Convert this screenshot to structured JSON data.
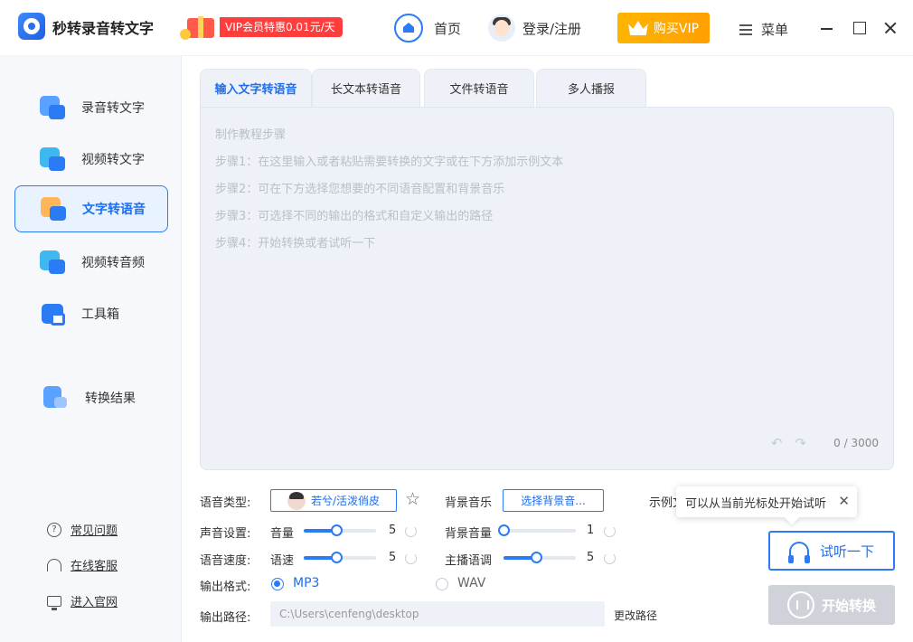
{
  "app": {
    "title": "秒转录音转文字",
    "vip_promo": "VIP会员特惠0.01元/天",
    "nav_home": "首页",
    "nav_login": "登录/注册",
    "buy_vip": "购买VIP",
    "menu": "菜单"
  },
  "sidebar": {
    "items": [
      {
        "label": "录音转文字",
        "icon": "mic-text-icon"
      },
      {
        "label": "视频转文字",
        "icon": "video-text-icon"
      },
      {
        "label": "文字转语音",
        "icon": "text-speech-icon"
      },
      {
        "label": "视频转音频",
        "icon": "video-audio-icon"
      },
      {
        "label": "工具箱",
        "icon": "toolbox-icon"
      },
      {
        "label": "转换结果",
        "icon": "result-icon"
      }
    ],
    "active_index": 2,
    "bottom": [
      {
        "label": "常见问题",
        "icon": "question-icon"
      },
      {
        "label": "在线客服",
        "icon": "headset-icon"
      },
      {
        "label": "进入官网",
        "icon": "monitor-icon"
      }
    ]
  },
  "tabs": [
    {
      "label": "输入文字转语音",
      "active": true
    },
    {
      "label": "长文本转语音",
      "active": false
    },
    {
      "label": "文件转语音",
      "active": false
    },
    {
      "label": "多人播报",
      "active": false
    }
  ],
  "editor": {
    "hint_title": "制作教程步骤",
    "steps": [
      "步骤1：在这里输入或者粘贴需要转换的文字或在下方添加示例文本",
      "步骤2：可在下方选择您想要的不同语音配置和背景音乐",
      "步骤3：可选择不同的输出的格式和自定义输出的路径",
      "步骤4：开始转换或者试听一下"
    ],
    "char_count": "0 / 3000"
  },
  "settings": {
    "voice_type_label": "语音类型:",
    "voice_name": "若兮/活泼俏皮",
    "bgm_label": "背景音乐",
    "bgm_button": "选择背景音...",
    "sound_label": "声音设置:",
    "volume_label": "音量",
    "volume_value": "5",
    "volume_level": 0.45,
    "bgm_volume_label": "背景音量",
    "bgm_volume_value": "1",
    "bgm_volume_level": 0.0,
    "speed_row_label": "语音速度:",
    "speed_label": "语速",
    "speed_value": "5",
    "speed_level": 0.45,
    "tone_label": "主播语调",
    "tone_value": "5",
    "tone_level": 0.45,
    "format_label": "输出格式:",
    "format_options": [
      "MP3",
      "WAV"
    ],
    "format_selected": "MP3",
    "path_label": "输出路径:",
    "path_value": "C:\\Users\\cenfeng\\desktop",
    "change_path": "更改路径"
  },
  "actions": {
    "example_label": "示例文",
    "tooltip": "可以从当前光标处开始试听",
    "listen_button": "试听一下",
    "start_button": "开始转换"
  },
  "colors": {
    "accent": "#2a7bf4",
    "vip_gold": "#ffb400",
    "promo_red": "#ff3d3d",
    "disabled": "#cfd3d9"
  }
}
